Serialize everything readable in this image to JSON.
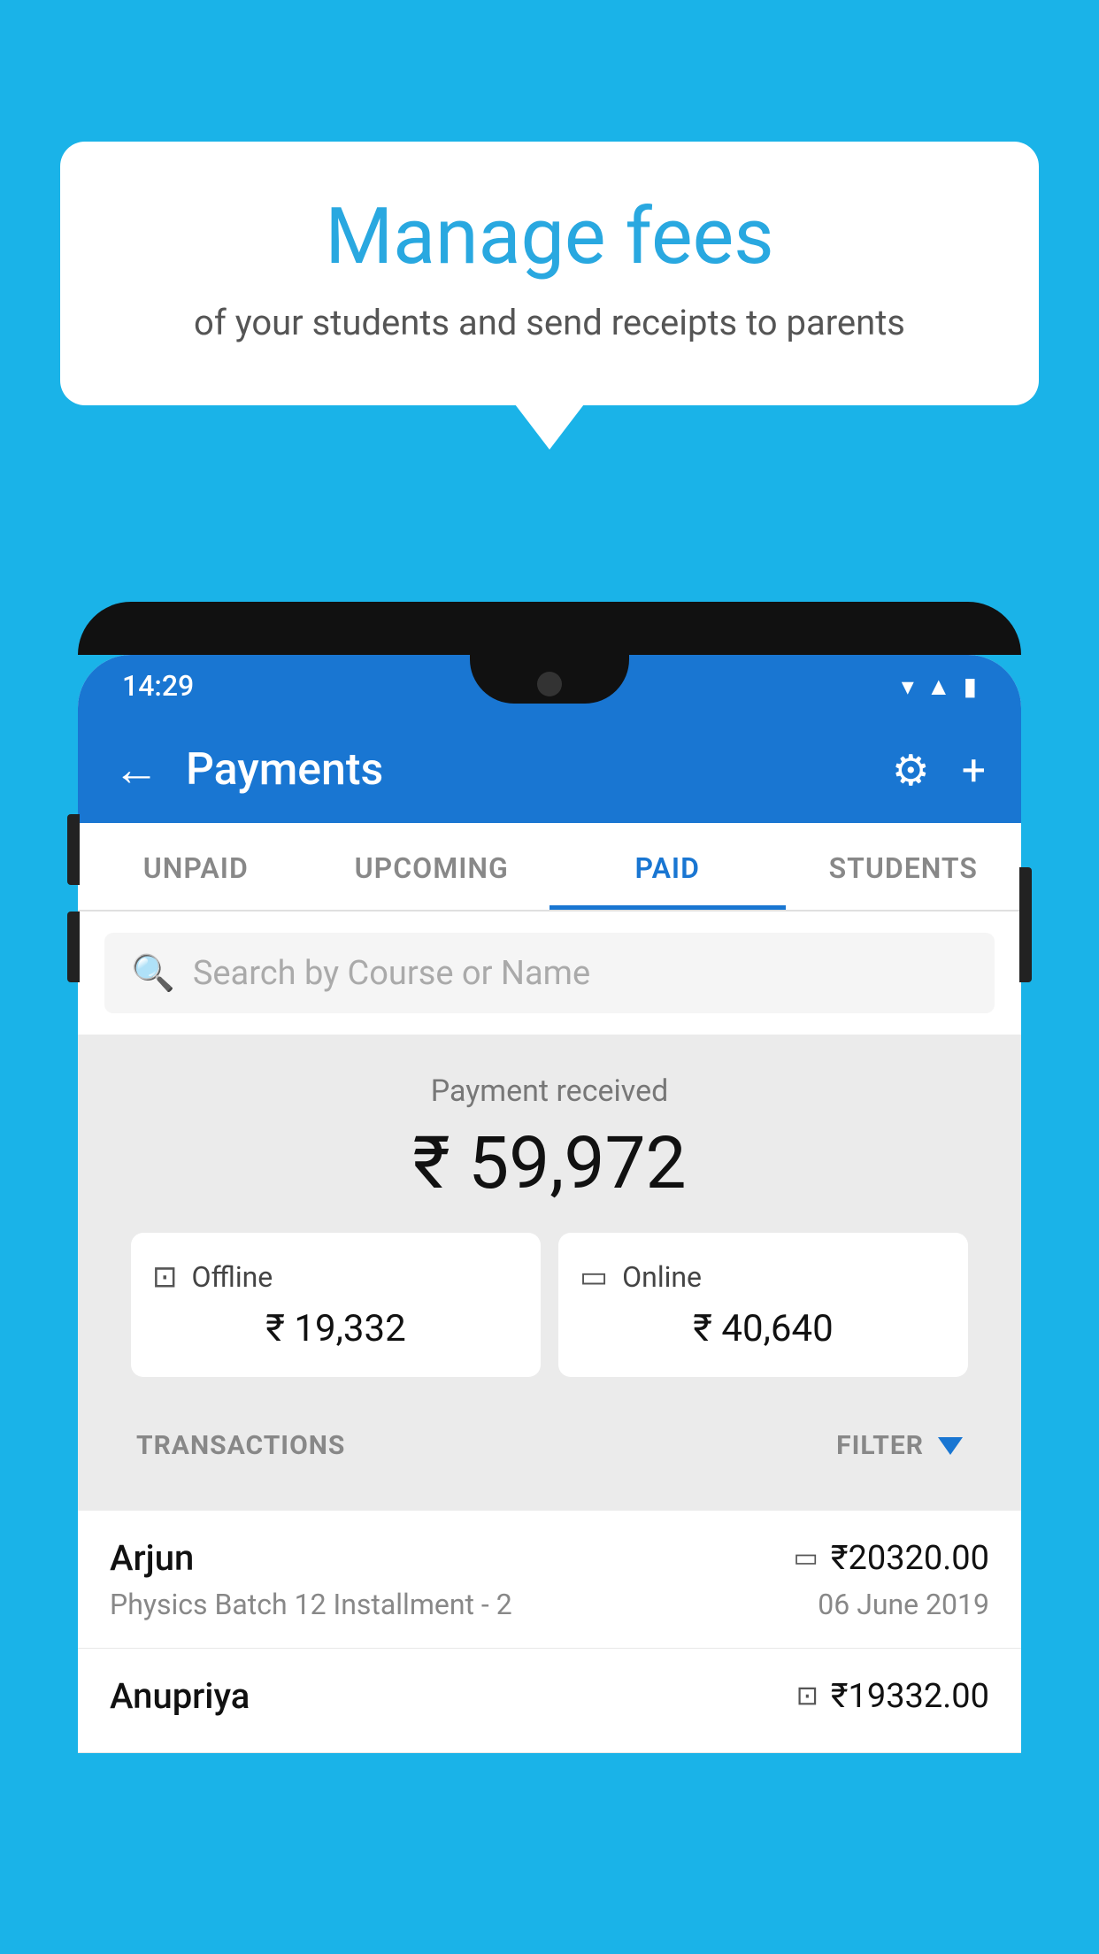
{
  "background_color": "#1ab3e8",
  "bubble": {
    "title": "Manage fees",
    "subtitle": "of your students and send receipts to parents"
  },
  "phone": {
    "status_bar": {
      "time": "14:29",
      "icons": [
        "wifi",
        "signal",
        "battery"
      ]
    },
    "app_bar": {
      "title": "Payments",
      "back_label": "←",
      "gear_label": "⚙",
      "plus_label": "+"
    },
    "tabs": [
      {
        "label": "UNPAID",
        "active": false
      },
      {
        "label": "UPCOMING",
        "active": false
      },
      {
        "label": "PAID",
        "active": true
      },
      {
        "label": "STUDENTS",
        "active": false
      }
    ],
    "search": {
      "placeholder": "Search by Course or Name"
    },
    "payment_received": {
      "label": "Payment received",
      "amount": "₹ 59,972"
    },
    "cards": [
      {
        "icon": "offline",
        "label": "Offline",
        "amount": "₹ 19,332"
      },
      {
        "icon": "online",
        "label": "Online",
        "amount": "₹ 40,640"
      }
    ],
    "transactions_label": "TRANSACTIONS",
    "filter_label": "FILTER",
    "transactions": [
      {
        "name": "Arjun",
        "course": "Physics Batch 12 Installment - 2",
        "amount": "₹20320.00",
        "date": "06 June 2019",
        "payment_type": "card"
      },
      {
        "name": "Anupriya",
        "course": "",
        "amount": "₹19332.00",
        "date": "",
        "payment_type": "offline"
      }
    ]
  }
}
